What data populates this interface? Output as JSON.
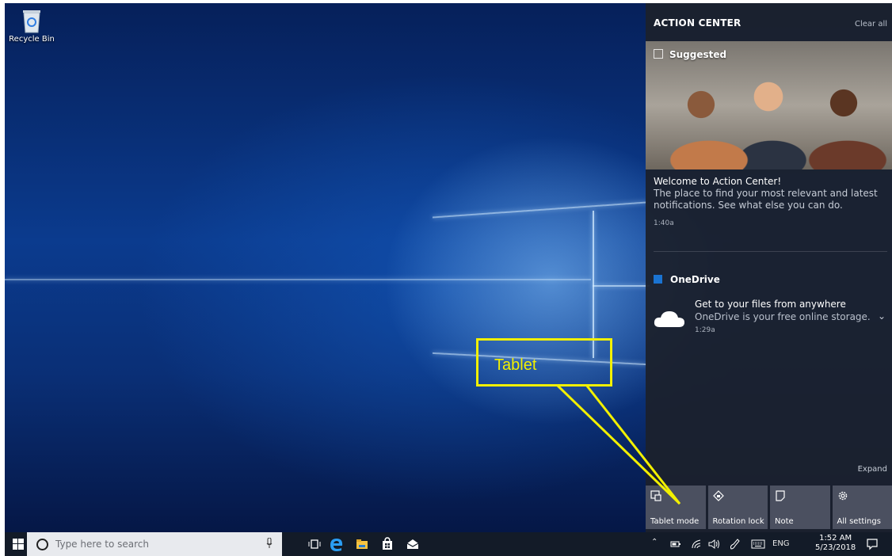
{
  "desktop": {
    "recycle_bin_label": "Recycle Bin"
  },
  "action_center": {
    "header": "ACTION CENTER",
    "clear_all": "Clear all",
    "suggested": {
      "label": "Suggested",
      "title": "Welcome to Action Center!",
      "body": "The place to find your most relevant and latest notifications. See what else you can do.",
      "time": "1:40a"
    },
    "onedrive": {
      "app_name": "OneDrive",
      "title": "Get to your files from anywhere",
      "body": "OneDrive is your free online storage. S",
      "time": "1:29a"
    },
    "expand": "Expand",
    "quick_actions": [
      {
        "label": "Tablet mode",
        "icon": "tablet-mode-icon"
      },
      {
        "label": "Rotation lock",
        "icon": "rotation-lock-icon"
      },
      {
        "label": "Note",
        "icon": "note-icon"
      },
      {
        "label": "All settings",
        "icon": "gear-icon"
      }
    ]
  },
  "annotation": {
    "callout_text": "Tablet",
    "color": "#f2f000"
  },
  "taskbar": {
    "search_placeholder": "Type here to search",
    "language": "ENG",
    "time": "1:52 AM",
    "date": "5/23/2018"
  }
}
